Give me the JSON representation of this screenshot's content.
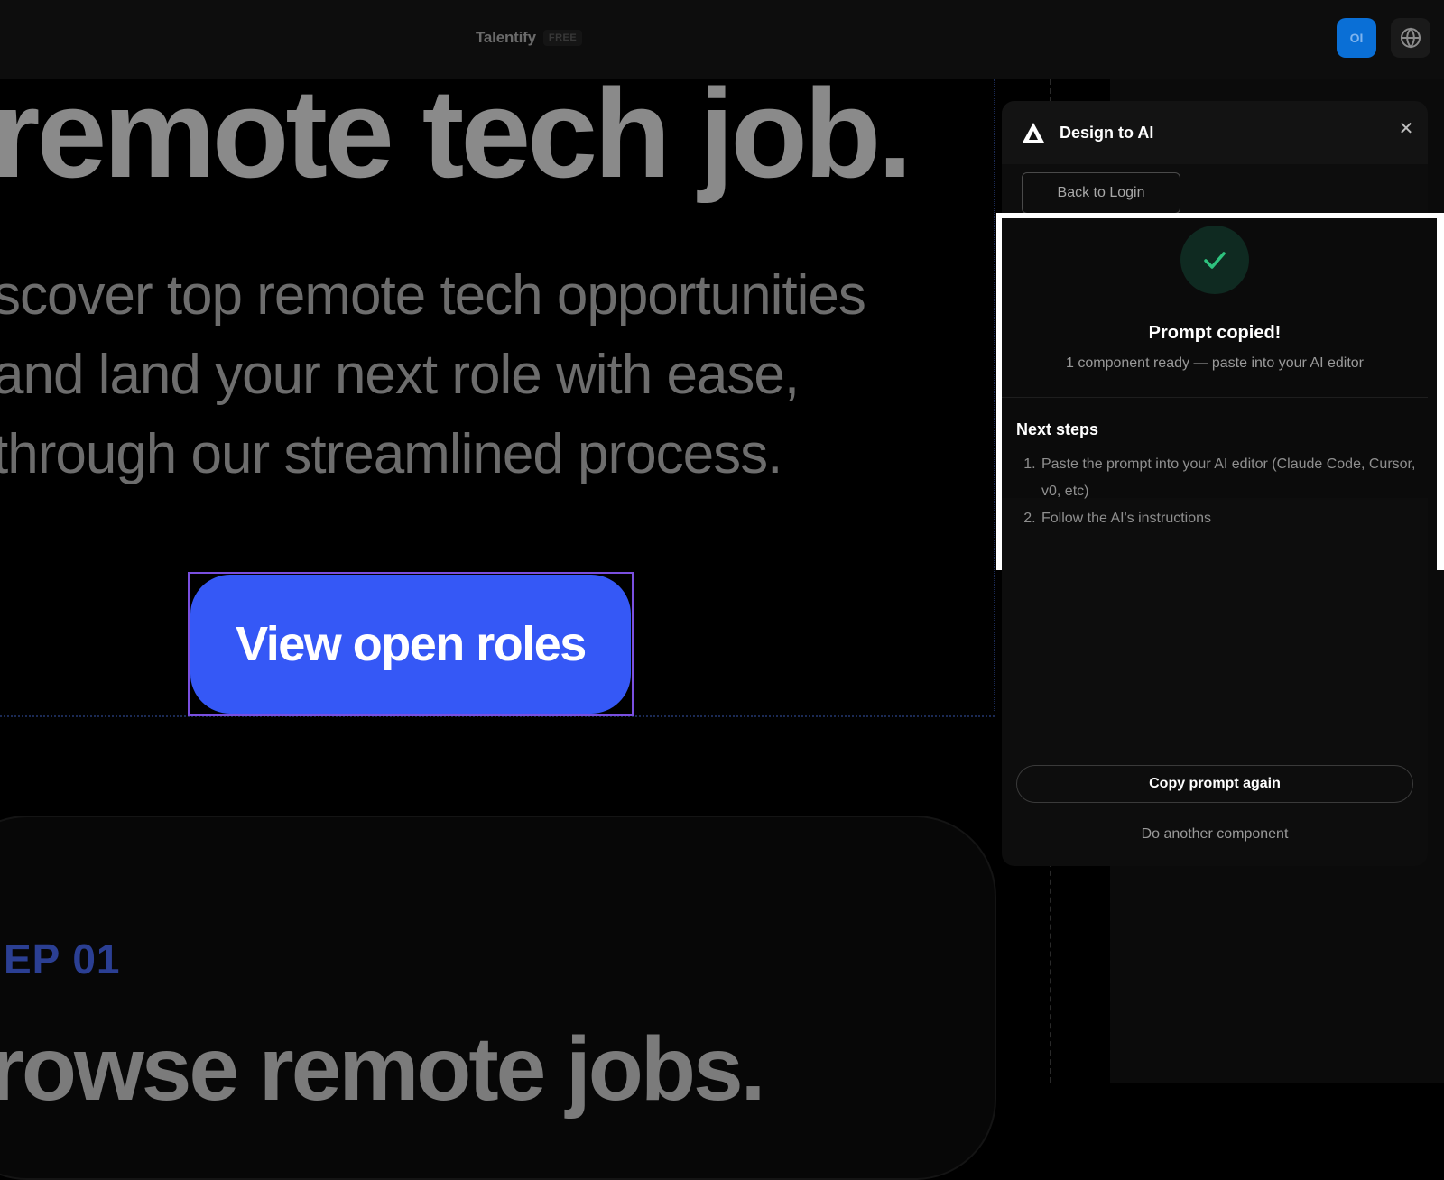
{
  "topbar": {
    "brand": "Talentify",
    "plan_badge": "FREE",
    "avatar_initials": "OI",
    "accent": "#0a6fd6"
  },
  "hero": {
    "title": "remote tech job.",
    "subtitle_lines": [
      "scover top remote tech opportunities",
      "and land your next role with ease,",
      "through our streamlined process."
    ],
    "cta_label": "View open roles",
    "cta_color": "#3558f6",
    "step_label": "EP 01",
    "step_title": "rowse remote jobs."
  },
  "panel": {
    "title": "Design to AI",
    "close_icon": "close-icon",
    "back_label": "Back to Login",
    "success_title": "Prompt copied!",
    "success_subtitle": "1 component ready — paste into your AI editor",
    "success_color": "#2ec27e",
    "next_steps_title": "Next steps",
    "next_steps": [
      "Paste the prompt into your AI editor (Claude Code, Cursor, v0, etc)",
      "Follow the AI's instructions"
    ],
    "copy_again_label": "Copy prompt again",
    "another_label": "Do another component"
  }
}
